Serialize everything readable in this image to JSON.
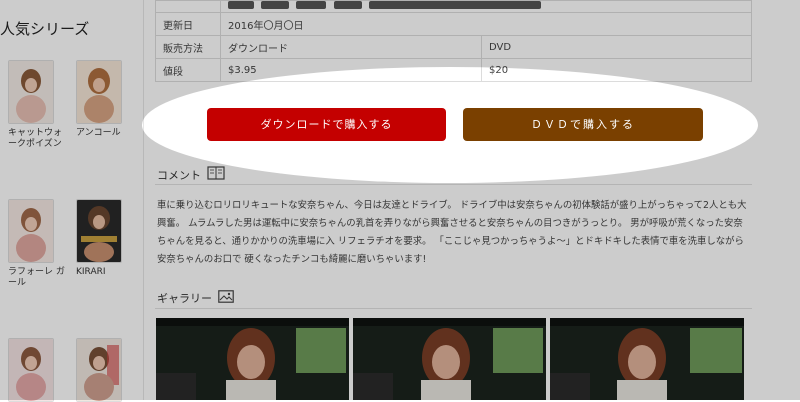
{
  "sidebar": {
    "title": "人気シリーズ",
    "items": [
      {
        "name": "キャットウォークポイズン",
        "shade": "#e8c0b4"
      },
      {
        "name": "アンコール",
        "shade": "#d8a484"
      },
      {
        "name": "ラフォーレ ガール",
        "shade": "#e0a8a0"
      },
      {
        "name": "KIRARI",
        "shade": "#c99070"
      },
      {
        "name": "",
        "shade": "#e4a8a8"
      },
      {
        "name": "",
        "shade": "#d0a090"
      }
    ]
  },
  "info": {
    "updated_label": "更新日",
    "updated_value": "2016年〇月〇日",
    "sales_label": "販売方法",
    "sales_download": "ダウンロード",
    "sales_dvd": "DVD",
    "price_label": "値段",
    "price_download": "$3.95",
    "price_dvd": "$20"
  },
  "buttons": {
    "download": "ダウンロードで購入する",
    "dvd": "ＤＶＤで購入する"
  },
  "comment": {
    "heading": "コメント",
    "text": "車に乗り込むロリロリキュートな安奈ちゃん、今日は友達とドライブ。 ドライブ中は安奈ちゃんの初体験話が盛り上がっちゃって2人とも大興奮。 ムラムラした男は運転中に安奈ちゃんの乳首を弄りながら興奮させると安奈ちゃんの目つきがうっとり。 男が呼吸が荒くなった安奈ちゃんを見ると、通りかかりの洗車場に入 リフェラチオを要求。 「ここじゃ見つかっちゃうよ～」とドキドキした表情で車を洗車しながら安奈ちゃんのお口で 硬くなったチンコも綺麗に磨いちゃいます!"
  },
  "gallery": {
    "heading": "ギャラリー",
    "count": 3
  },
  "colors": {
    "download_button": "#c40000",
    "dvd_button": "#7a4000",
    "price_text": "#c0392b"
  }
}
